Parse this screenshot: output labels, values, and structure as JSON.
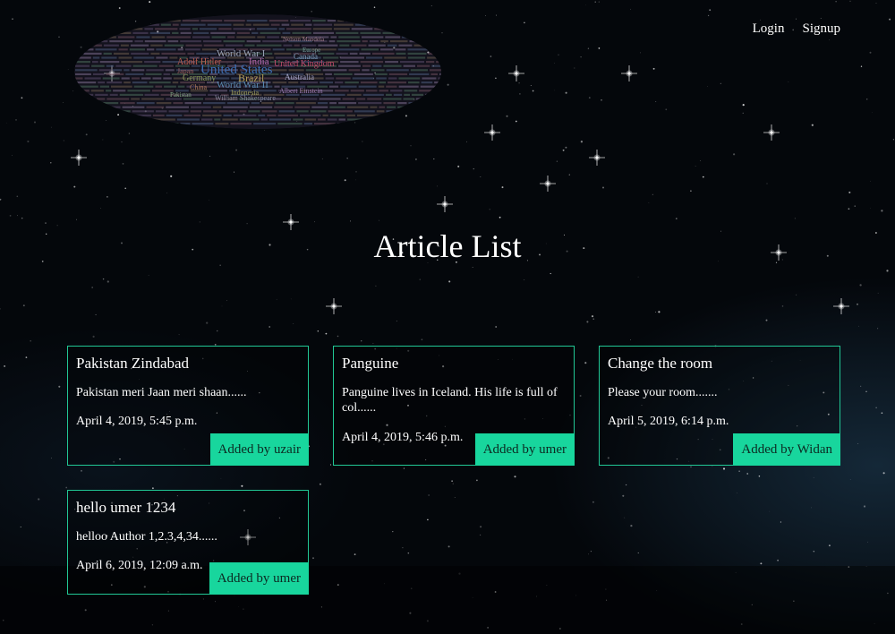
{
  "nav": {
    "login_label": "Login",
    "signup_label": "Signup"
  },
  "logo": {
    "words": [
      "World War I",
      "United States",
      "United Kingdom",
      "India",
      "Brazil",
      "Germany",
      "Australia",
      "Adolf Hitler",
      "Canada",
      "Japan",
      "World War II",
      "Indonesia",
      "Albert Einstein",
      "William Shakespeare",
      "China",
      "Europe",
      "Nelson Mandela",
      "Pakistan"
    ]
  },
  "page": {
    "title": "Article List"
  },
  "articles": [
    {
      "title": "Pakistan Zindabad",
      "snippet": "Pakistan meri Jaan meri shaan......",
      "date": "April 4, 2019, 5:45 p.m.",
      "author": "Added by uzair"
    },
    {
      "title": "Panguine",
      "snippet": "Panguine lives in Iceland. His life is full of col......",
      "date": "April 4, 2019, 5:46 p.m.",
      "author": "Added by umer"
    },
    {
      "title": "Change the room",
      "snippet": "Please your room.......",
      "date": "April 5, 2019, 6:14 p.m.",
      "author": "Added by Widan"
    },
    {
      "title": "hello umer 1234",
      "snippet": "helloo Author 1,2.3,4,34......",
      "date": "April 6, 2019, 12:09 a.m.",
      "author": "Added by umer"
    }
  ],
  "colors": {
    "card_border": "#21c795",
    "author_badge_bg": "#18d69d",
    "background": "#04070b"
  }
}
